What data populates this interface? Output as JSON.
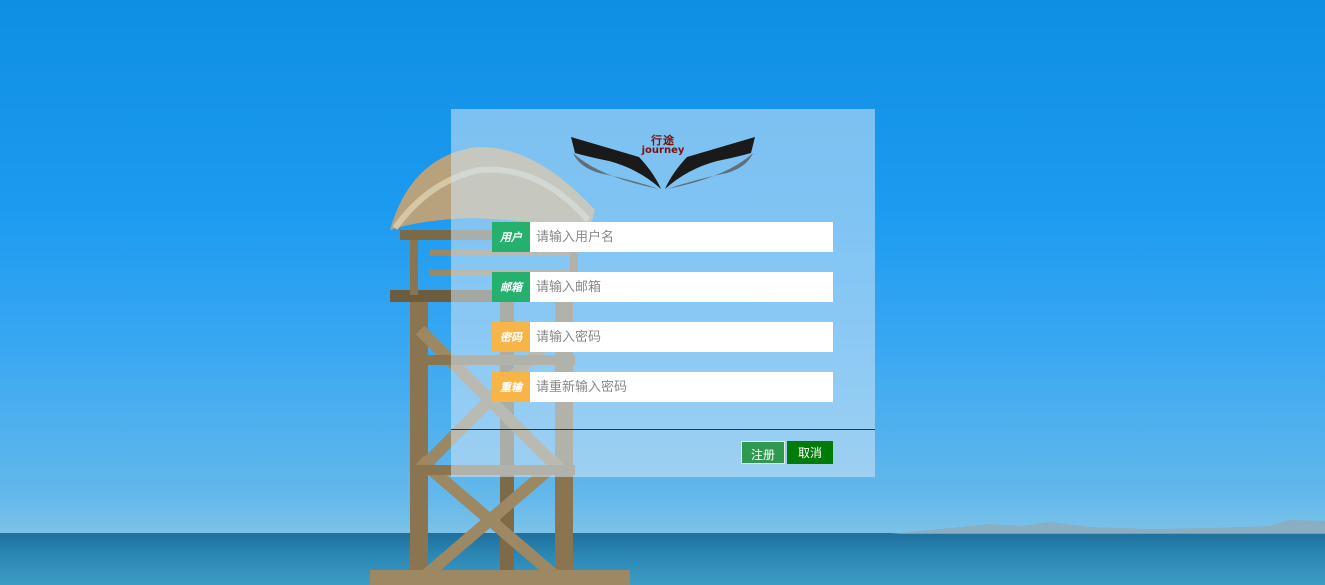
{
  "logo": {
    "text_cn": "行途",
    "text_en": "journey"
  },
  "form": {
    "fields": [
      {
        "label": "用户",
        "placeholder": "请输入用户名",
        "value": "",
        "color": "#26b06d"
      },
      {
        "label": "邮箱",
        "placeholder": "请输入邮箱",
        "value": "",
        "color": "#26b06d"
      },
      {
        "label": "密码",
        "placeholder": "请输入密码",
        "value": "",
        "color": "#f7b548"
      },
      {
        "label": "重输",
        "placeholder": "请重新输入密码",
        "value": "",
        "color": "#f7b548"
      }
    ]
  },
  "buttons": {
    "register_label": "注册",
    "cancel_label": "取消"
  },
  "colors": {
    "sky": "#1b9af0",
    "register_button": "#2f9a4f",
    "cancel_button": "#027c08"
  }
}
